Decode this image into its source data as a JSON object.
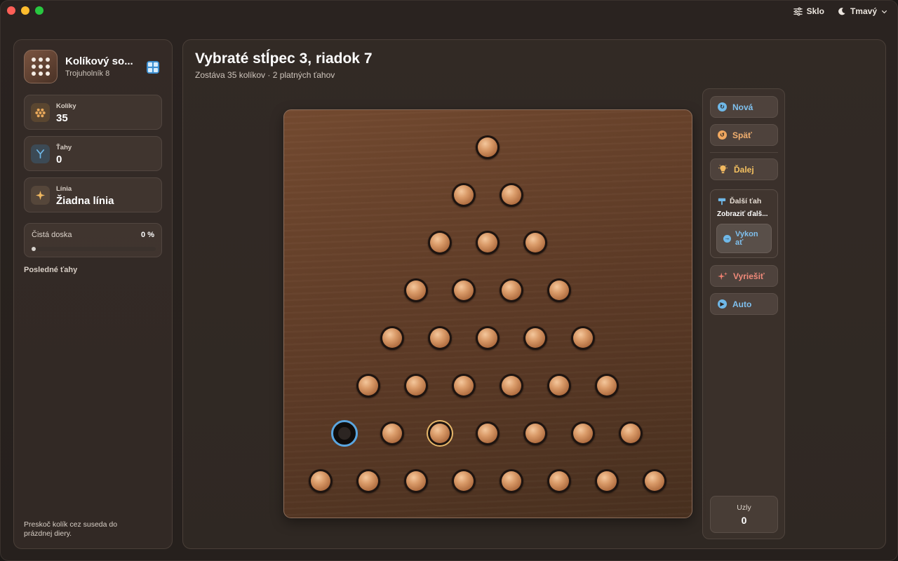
{
  "titlebar": {
    "glass_label": "Sklo",
    "theme_label": "Tmavý"
  },
  "sidebar": {
    "app_title": "Kolíkový so...",
    "app_subtitle": "Trojuholník 8",
    "stats": [
      {
        "label": "Kolíky",
        "value": "35",
        "icon": "pegs-icon",
        "color": "#e8a85a"
      },
      {
        "label": "Ťahy",
        "value": "0",
        "icon": "branch-icon",
        "color": "#6fb8e8"
      },
      {
        "label": "Línia",
        "value": "Žiadna línia",
        "icon": "sparkle-icon",
        "color": "#f0b860"
      }
    ],
    "progress": {
      "label": "Čistá doska",
      "value_text": "0 %",
      "fraction": 0
    },
    "recent_moves_label": "Posledné ťahy",
    "hint": "Preskoč kolík cez suseda do prázdnej diery."
  },
  "main": {
    "title": "Vybraté stĺpec 3, riadok 7",
    "subtitle": "Zostáva 35 kolíkov · 2 platných ťahov"
  },
  "board": {
    "rows": 8,
    "empty": {
      "row": 7,
      "col": 1
    },
    "selected": {
      "row": 7,
      "col": 3
    }
  },
  "panel": {
    "new_label": "Nová",
    "undo_label": "Späť",
    "next_label": "Ďalej",
    "next_move_title": "Ďalší ťah",
    "next_move_text": "Zobraziť ďalš...",
    "execute_label": "Vykon ať",
    "solve_label": "Vyriešiť",
    "auto_label": "Auto",
    "nodes_label": "Uzly",
    "nodes_value": "0"
  },
  "colors": {
    "accent_blue": "#6fb8e8",
    "accent_orange": "#f0a860",
    "accent_red": "#f08070",
    "selected_ring": "#e8b86a",
    "hole_ring": "#5aa6e0"
  }
}
